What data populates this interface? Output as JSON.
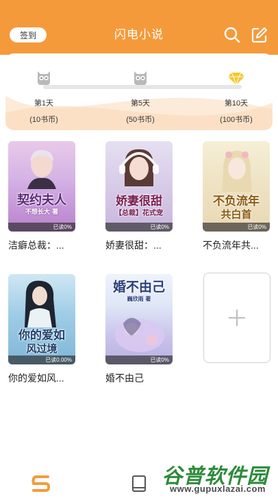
{
  "header": {
    "checkin_label": "签到",
    "title": "闪电小说",
    "icons": [
      "search-icon",
      "edit-icon"
    ],
    "background": "#f59a3b"
  },
  "checkin_rewards": {
    "progress": 0,
    "milestones": [
      {
        "day": "第1天",
        "reward": "(10书币)",
        "icon": "owl-icon"
      },
      {
        "day": "第5天",
        "reward": "(50书币)",
        "icon": "owl-icon"
      },
      {
        "day": "第10天",
        "reward": "(100书币)",
        "icon": "diamond-icon"
      }
    ]
  },
  "bookshelf": [
    {
      "title": "洁癖总裁：...",
      "cover_text": "契约夫人",
      "cover_small": "不想长大 著",
      "read": "已读0%"
    },
    {
      "title": "娇妻很甜：...",
      "cover_text": "娇妻很甜",
      "cover_small": "【总裁】花式宠",
      "read": "已读0%"
    },
    {
      "title": "不负流年共...",
      "cover_text": "不负流年",
      "cover_small": "共白首",
      "read": "已读0%"
    },
    {
      "title": "你的爱如风...",
      "cover_text": "你的爱如",
      "cover_small": "风过境",
      "read": "已读0.00%"
    },
    {
      "title": "婚不由己",
      "cover_text": "婚不由己",
      "cover_small": "巍欣雨 著",
      "read": "已读0%"
    }
  ],
  "add_book": {
    "icon": "plus-icon"
  },
  "tabbar": {
    "icons": [
      "bookshelf-icon",
      "book-icon"
    ]
  },
  "watermark": {
    "text": "谷普软件园",
    "url": "www.gupuxlazai.com"
  }
}
